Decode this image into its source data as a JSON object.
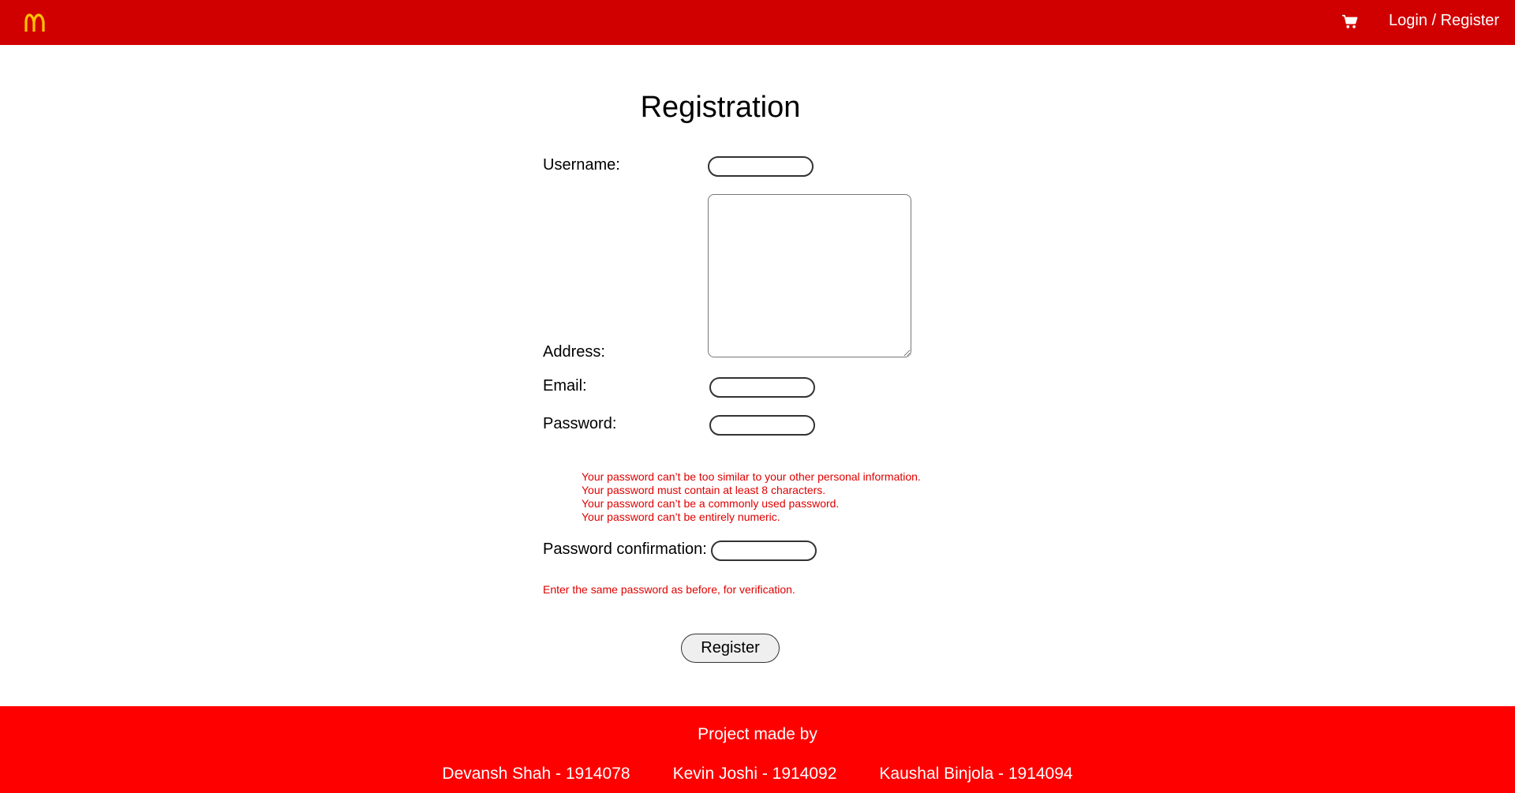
{
  "header": {
    "logo_icon": "mcdonalds-arches-logo",
    "cart_icon": "shopping-cart-icon",
    "auth_link": "Login / Register",
    "bg_color": "#d10000",
    "logo_color": "#ffc300"
  },
  "form": {
    "title": "Registration",
    "username_label": "Username:",
    "address_label": "Address:",
    "email_label": "Email:",
    "password_label": "Password:",
    "password_help": [
      "Your password can’t be too similar to your other personal information.",
      "Your password must contain at least 8 characters.",
      "Your password can’t be a commonly used password.",
      "Your password can’t be entirely numeric."
    ],
    "password_confirmation_label": "Password confirmation:",
    "password_confirmation_help": "Enter the same password as before, for verification.",
    "submit_label": "Register",
    "help_color": "#e00000"
  },
  "footer": {
    "heading": "Project made by",
    "credits": [
      "Devansh Shah - 1914078",
      "Kevin Joshi - 1914092",
      "Kaushal Binjola - 1914094"
    ],
    "bg_color": "#ff0000"
  }
}
